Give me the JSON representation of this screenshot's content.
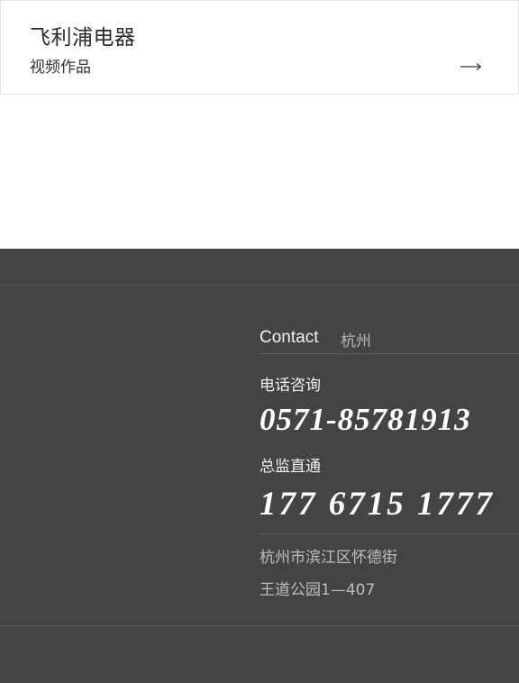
{
  "card": {
    "title": "飞利浦电器",
    "subtitle": "视频作品",
    "arrow_icon": "long-arrow-right-icon"
  },
  "footer": {
    "contact_label": "Contact",
    "contact_city": "杭州",
    "hotline_label": "电话咨询",
    "hotline_number": "0571-85781913",
    "director_label": "总监直通",
    "director_number": "177 6715 1777",
    "address_line1": "杭州市滨江区怀德街",
    "address_line2": "王道公园1—407"
  },
  "colors": {
    "footer_bg": "#444444",
    "footer_text": "#ffffff",
    "muted_text": "#bdbdbd"
  }
}
